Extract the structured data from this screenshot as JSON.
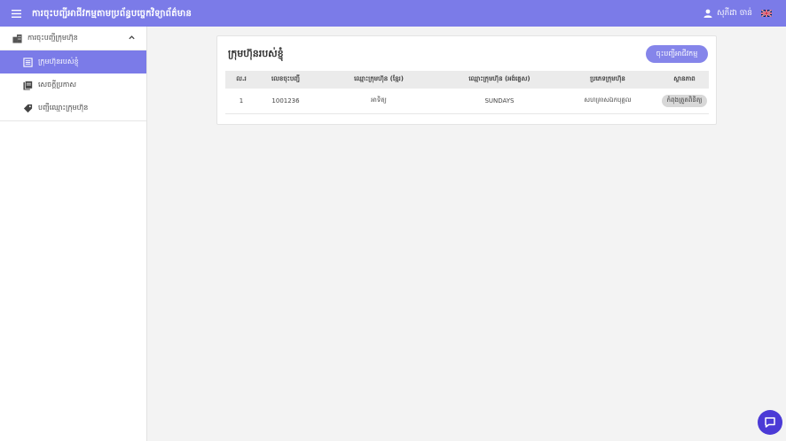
{
  "header": {
    "title": "ការចុះបញ្ជីអាជីវកម្មតាមប្រព័ន្ធបច្ចេកវិទ្យាព័ត៌មាន",
    "user_name": "សុភីដា ចាន់",
    "language_flag": "uk-flag-icon"
  },
  "sidebar": {
    "group_label": "ការចុះបញ្ជីក្រុមហ៊ុន",
    "items": [
      {
        "label": "ក្រុមហ៊ុនរបស់ខ្ញុំ",
        "icon": "list-icon",
        "active": true
      },
      {
        "label": "សេចក្ដីប្រកាស",
        "icon": "book-icon",
        "active": false
      },
      {
        "label": "បញ្ជីឈ្មោះក្រុមហ៊ុន",
        "icon": "tag-icon",
        "active": false
      }
    ]
  },
  "main": {
    "title": "ក្រុមហ៊ុនរបស់ខ្ញុំ",
    "register_button": "ចុះបញ្ជីអាជីវកម្ម",
    "table": {
      "headers": [
        "ល.រ",
        "លេខចុះបញ្ជី",
        "ឈ្មោះក្រុមហ៊ុន (ខ្មែរ)",
        "ឈ្មោះក្រុមហ៊ុន (អង់គ្លេស)",
        "ប្រភេទក្រុមហ៊ុន",
        "ស្ថានភាព"
      ],
      "rows": [
        [
          "1",
          "1001236",
          "អាទិត្យ",
          "SUNDAYS",
          "សហគ្រាសឯកបុគ្គល",
          "កំពុងត្រួតពិនិត្យ"
        ]
      ]
    }
  },
  "colors": {
    "primary": "#7b7be8",
    "chat": "#4b3ad6"
  }
}
